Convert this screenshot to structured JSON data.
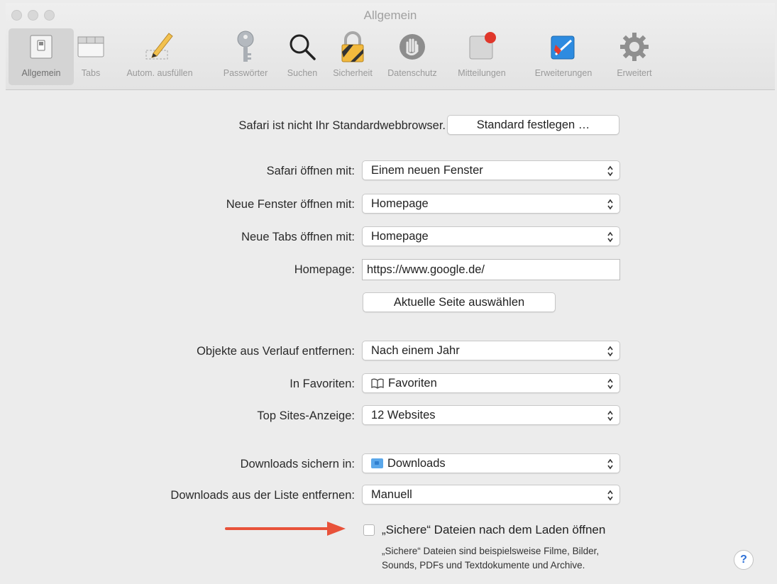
{
  "window": {
    "title": "Allgemein"
  },
  "toolbar": {
    "tabs": [
      {
        "label": "Allgemein",
        "icon": "general-switch-icon"
      },
      {
        "label": "Tabs",
        "icon": "tabs-icon"
      },
      {
        "label": "Autom. ausfüllen",
        "icon": "pencil-icon"
      },
      {
        "label": "Passwörter",
        "icon": "key-icon"
      },
      {
        "label": "Suchen",
        "icon": "magnifier-icon"
      },
      {
        "label": "Sicherheit",
        "icon": "lock-icon"
      },
      {
        "label": "Datenschutz",
        "icon": "hand-icon"
      },
      {
        "label": "Mitteilungen",
        "icon": "notifications-icon"
      },
      {
        "label": "Erweiterungen",
        "icon": "puzzle-icon"
      },
      {
        "label": "Erweitert",
        "icon": "gear-icon"
      }
    ]
  },
  "general": {
    "default_browser_text": "Safari ist nicht Ihr Standardwebbrowser.",
    "set_default_button": "Standard festlegen …",
    "open_with_label": "Safari öffnen mit:",
    "open_with_value": "Einem neuen Fenster",
    "new_windows_label": "Neue Fenster öffnen mit:",
    "new_windows_value": "Homepage",
    "new_tabs_label": "Neue Tabs öffnen mit:",
    "new_tabs_value": "Homepage",
    "homepage_label": "Homepage:",
    "homepage_value": "https://www.google.de/",
    "current_page_button": "Aktuelle Seite auswählen",
    "remove_history_label": "Objekte aus Verlauf entfernen:",
    "remove_history_value": "Nach einem Jahr",
    "favorites_label": "In Favoriten:",
    "favorites_value": "Favoriten",
    "top_sites_label": "Top Sites-Anzeige:",
    "top_sites_value": "12 Websites",
    "downloads_folder_label": "Downloads sichern in:",
    "downloads_folder_value": "Downloads",
    "downloads_remove_label": "Downloads aus der Liste entfernen:",
    "downloads_remove_value": "Manuell",
    "safe_files_checkbox_label": "„Sichere“ Dateien nach dem Laden öffnen",
    "safe_files_checked": false,
    "safe_files_help_line1": "„Sichere“ Dateien sind beispielsweise Filme, Bilder,",
    "safe_files_help_line2": "Sounds, PDFs und Textdokumente und Archive.",
    "help_button": "?"
  },
  "colors": {
    "annotation_arrow": "#e8523a",
    "help_blue": "#2c6fd6",
    "folder_blue": "#5aa7ea"
  }
}
